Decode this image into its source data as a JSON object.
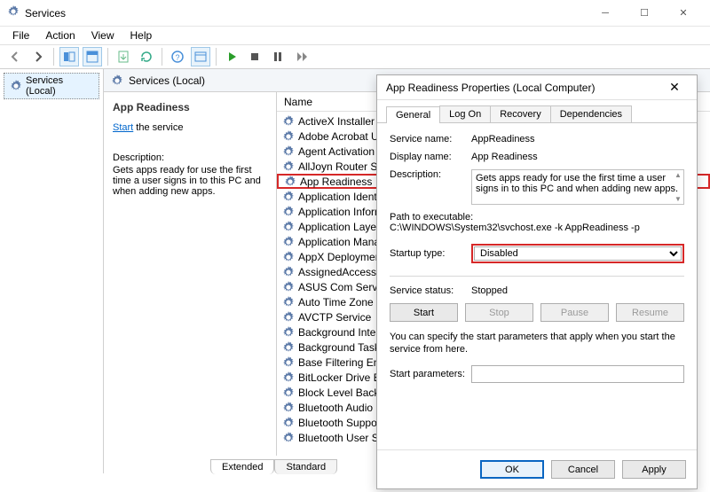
{
  "window": {
    "title": "Services"
  },
  "menu": {
    "file": "File",
    "action": "Action",
    "view": "View",
    "help": "Help"
  },
  "tree": {
    "root": "Services (Local)"
  },
  "pane": {
    "header": "Services (Local)"
  },
  "detail": {
    "name": "App Readiness",
    "start_link": "Start",
    "start_suffix": " the service",
    "desc_label": "Description:",
    "desc": "Gets apps ready for use the first time a user signs in to this PC and when adding new apps."
  },
  "list": {
    "header": "Name",
    "items": [
      "ActiveX Installer (AxInstSV)",
      "Adobe Acrobat Update Service",
      "Agent Activation Runtime",
      "AllJoyn Router Service",
      "App Readiness",
      "Application Identity",
      "Application Information",
      "Application Layer Gateway",
      "Application Management",
      "AppX Deployment Service",
      "AssignedAccessManager",
      "ASUS Com Service",
      "Auto Time Zone Updater",
      "AVCTP Service",
      "Background Intelligent Transfer",
      "Background Tasks Infrastructure",
      "Base Filtering Engine",
      "BitLocker Drive Encryption",
      "Block Level Backup",
      "Bluetooth Audio Gateway",
      "Bluetooth Support Service",
      "Bluetooth User Support"
    ],
    "selected_index": 4
  },
  "tabs": {
    "extended": "Extended",
    "standard": "Standard"
  },
  "dialog": {
    "title": "App Readiness Properties (Local Computer)",
    "tabs": {
      "general": "General",
      "logon": "Log On",
      "recovery": "Recovery",
      "dependencies": "Dependencies"
    },
    "fields": {
      "service_name_label": "Service name:",
      "service_name": "AppReadiness",
      "display_name_label": "Display name:",
      "display_name": "App Readiness",
      "description_label": "Description:",
      "description": "Gets apps ready for use the first time a user signs in to this PC and when adding new apps.",
      "path_label": "Path to executable:",
      "path": "C:\\WINDOWS\\System32\\svchost.exe -k AppReadiness -p",
      "startup_label": "Startup type:",
      "startup_value": "Disabled",
      "status_label": "Service status:",
      "status_value": "Stopped",
      "start_btn": "Start",
      "stop_btn": "Stop",
      "pause_btn": "Pause",
      "resume_btn": "Resume",
      "note": "You can specify the start parameters that apply when you start the service from here.",
      "params_label": "Start parameters:",
      "params_value": ""
    },
    "buttons": {
      "ok": "OK",
      "cancel": "Cancel",
      "apply": "Apply"
    }
  }
}
